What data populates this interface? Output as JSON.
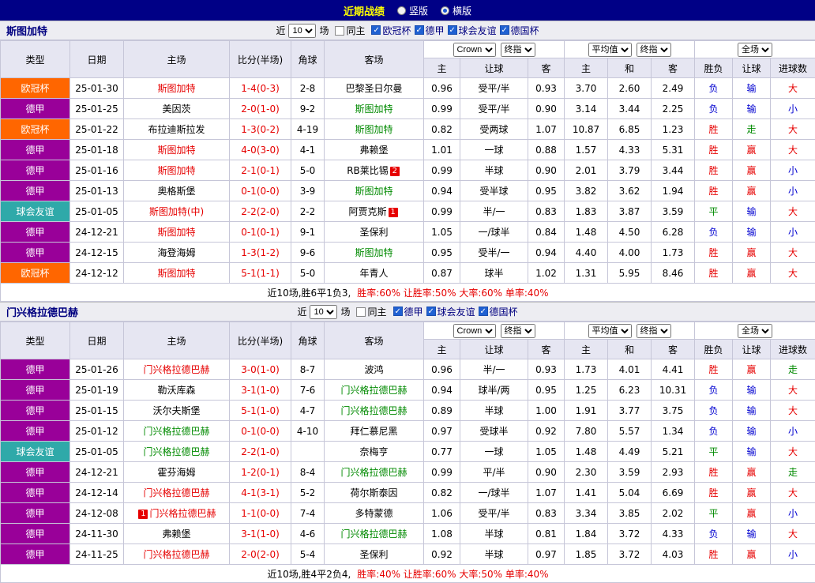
{
  "topbar": {
    "title": "近期战绩",
    "layout_options": [
      {
        "label": "竖版",
        "selected": false
      },
      {
        "label": "横版",
        "selected": true
      }
    ]
  },
  "colors": {
    "accent_navy": "#000086",
    "title_yellow": "#ffff00",
    "score_text": "#e60000",
    "type_bg": {
      "欧冠杯": "#ff6600",
      "德甲": "#990099",
      "球会友谊": "#2fa9a9"
    },
    "team_text": {
      "red": "#e60000",
      "green": "#008a00"
    },
    "result_text": {
      "胜": "#e60000",
      "赢": "#e60000",
      "大": "#e60000",
      "负": "#0000d0",
      "输": "#0000d0",
      "小": "#0000d0",
      "平": "#008a00",
      "走": "#008a00"
    }
  },
  "table_columns": [
    "类型",
    "日期",
    "主场",
    "比分(半场)",
    "角球",
    "客场",
    "主",
    "让球",
    "客",
    "主",
    "和",
    "客",
    "胜负",
    "让球",
    "进球数"
  ],
  "header_controls": {
    "near_label": "近",
    "near_value": "10",
    "games_label": "场",
    "odds_company": "Crown",
    "final_odds_label": "终指",
    "average_label": "平均值",
    "scope_label": "全场"
  },
  "sections": [
    {
      "team": "斯图加特",
      "filter": {
        "same_venue": {
          "label": "同主",
          "checked": false
        },
        "leagues": [
          {
            "label": "欧冠杯",
            "checked": true
          },
          {
            "label": "德甲",
            "checked": true
          },
          {
            "label": "球会友谊",
            "checked": true
          },
          {
            "label": "德国杯",
            "checked": true
          }
        ]
      },
      "rows": [
        {
          "type": "欧冠杯",
          "date": "25-01-30",
          "home": "斯图加特",
          "home_color": "red",
          "home_badge": "",
          "score": "1-4(0-3)",
          "corner": "2-8",
          "away": "巴黎圣日尔曼",
          "away_color": "",
          "away_badge": "",
          "odds": [
            "0.96",
            "受平/半",
            "0.93"
          ],
          "avg": [
            "3.70",
            "2.60",
            "2.49"
          ],
          "result": [
            "负",
            "输",
            "大"
          ]
        },
        {
          "type": "德甲",
          "date": "25-01-25",
          "home": "美因茨",
          "home_color": "",
          "home_badge": "",
          "score": "2-0(1-0)",
          "corner": "9-2",
          "away": "斯图加特",
          "away_color": "green",
          "away_badge": "",
          "odds": [
            "0.99",
            "受平/半",
            "0.90"
          ],
          "avg": [
            "3.14",
            "3.44",
            "2.25"
          ],
          "result": [
            "负",
            "输",
            "小"
          ]
        },
        {
          "type": "欧冠杯",
          "date": "25-01-22",
          "home": "布拉迪斯拉发",
          "home_color": "",
          "home_badge": "",
          "score": "1-3(0-2)",
          "corner": "4-19",
          "away": "斯图加特",
          "away_color": "green",
          "away_badge": "",
          "odds": [
            "0.82",
            "受两球",
            "1.07"
          ],
          "avg": [
            "10.87",
            "6.85",
            "1.23"
          ],
          "result": [
            "胜",
            "走",
            "大"
          ]
        },
        {
          "type": "德甲",
          "date": "25-01-18",
          "home": "斯图加特",
          "home_color": "red",
          "home_badge": "",
          "score": "4-0(3-0)",
          "corner": "4-1",
          "away": "弗赖堡",
          "away_color": "",
          "away_badge": "",
          "odds": [
            "1.01",
            "一球",
            "0.88"
          ],
          "avg": [
            "1.57",
            "4.33",
            "5.31"
          ],
          "result": [
            "胜",
            "赢",
            "大"
          ]
        },
        {
          "type": "德甲",
          "date": "25-01-16",
          "home": "斯图加特",
          "home_color": "red",
          "home_badge": "",
          "score": "2-1(0-1)",
          "corner": "5-0",
          "away": "RB莱比锡",
          "away_color": "",
          "away_badge": "2",
          "odds": [
            "0.99",
            "半球",
            "0.90"
          ],
          "avg": [
            "2.01",
            "3.79",
            "3.44"
          ],
          "result": [
            "胜",
            "赢",
            "小"
          ]
        },
        {
          "type": "德甲",
          "date": "25-01-13",
          "home": "奥格斯堡",
          "home_color": "",
          "home_badge": "",
          "score": "0-1(0-0)",
          "corner": "3-9",
          "away": "斯图加特",
          "away_color": "green",
          "away_badge": "",
          "odds": [
            "0.94",
            "受半球",
            "0.95"
          ],
          "avg": [
            "3.82",
            "3.62",
            "1.94"
          ],
          "result": [
            "胜",
            "赢",
            "小"
          ]
        },
        {
          "type": "球会友谊",
          "date": "25-01-05",
          "home": "斯图加特(中)",
          "home_color": "red",
          "home_badge": "",
          "score": "2-2(2-0)",
          "corner": "2-2",
          "away": "阿贾克斯",
          "away_color": "",
          "away_badge": "1",
          "odds": [
            "0.99",
            "半/一",
            "0.83"
          ],
          "avg": [
            "1.83",
            "3.87",
            "3.59"
          ],
          "result": [
            "平",
            "输",
            "大"
          ]
        },
        {
          "type": "德甲",
          "date": "24-12-21",
          "home": "斯图加特",
          "home_color": "red",
          "home_badge": "",
          "score": "0-1(0-1)",
          "corner": "9-1",
          "away": "圣保利",
          "away_color": "",
          "away_badge": "",
          "odds": [
            "1.05",
            "一/球半",
            "0.84"
          ],
          "avg": [
            "1.48",
            "4.50",
            "6.28"
          ],
          "result": [
            "负",
            "输",
            "小"
          ]
        },
        {
          "type": "德甲",
          "date": "24-12-15",
          "home": "海登海姆",
          "home_color": "",
          "home_badge": "",
          "score": "1-3(1-2)",
          "corner": "9-6",
          "away": "斯图加特",
          "away_color": "green",
          "away_badge": "",
          "odds": [
            "0.95",
            "受半/一",
            "0.94"
          ],
          "avg": [
            "4.40",
            "4.00",
            "1.73"
          ],
          "result": [
            "胜",
            "赢",
            "大"
          ]
        },
        {
          "type": "欧冠杯",
          "date": "24-12-12",
          "home": "斯图加特",
          "home_color": "red",
          "home_badge": "",
          "score": "5-1(1-1)",
          "corner": "5-0",
          "away": "年青人",
          "away_color": "",
          "away_badge": "",
          "odds": [
            "0.87",
            "球半",
            "1.02"
          ],
          "avg": [
            "1.31",
            "5.95",
            "8.46"
          ],
          "result": [
            "胜",
            "赢",
            "大"
          ]
        }
      ],
      "summary": {
        "record": "近10场,胜6平1负3,",
        "stats": "胜率:60% 让胜率:50% 大率:60% 单率:40%"
      }
    },
    {
      "team": "门兴格拉德巴赫",
      "filter": {
        "same_venue": {
          "label": "同主",
          "checked": false
        },
        "leagues": [
          {
            "label": "德甲",
            "checked": true
          },
          {
            "label": "球会友谊",
            "checked": true
          },
          {
            "label": "德国杯",
            "checked": true
          }
        ]
      },
      "rows": [
        {
          "type": "德甲",
          "date": "25-01-26",
          "home": "门兴格拉德巴赫",
          "home_color": "red",
          "home_badge": "",
          "score": "3-0(1-0)",
          "corner": "8-7",
          "away": "波鸿",
          "away_color": "",
          "away_badge": "",
          "odds": [
            "0.96",
            "半/一",
            "0.93"
          ],
          "avg": [
            "1.73",
            "4.01",
            "4.41"
          ],
          "result": [
            "胜",
            "赢",
            "走"
          ]
        },
        {
          "type": "德甲",
          "date": "25-01-19",
          "home": "勒沃库森",
          "home_color": "",
          "home_badge": "",
          "score": "3-1(1-0)",
          "corner": "7-6",
          "away": "门兴格拉德巴赫",
          "away_color": "green",
          "away_badge": "",
          "odds": [
            "0.94",
            "球半/两",
            "0.95"
          ],
          "avg": [
            "1.25",
            "6.23",
            "10.31"
          ],
          "result": [
            "负",
            "输",
            "大"
          ]
        },
        {
          "type": "德甲",
          "date": "25-01-15",
          "home": "沃尔夫斯堡",
          "home_color": "",
          "home_badge": "",
          "score": "5-1(1-0)",
          "corner": "4-7",
          "away": "门兴格拉德巴赫",
          "away_color": "green",
          "away_badge": "",
          "odds": [
            "0.89",
            "半球",
            "1.00"
          ],
          "avg": [
            "1.91",
            "3.77",
            "3.75"
          ],
          "result": [
            "负",
            "输",
            "大"
          ]
        },
        {
          "type": "德甲",
          "date": "25-01-12",
          "home": "门兴格拉德巴赫",
          "home_color": "green",
          "home_badge": "",
          "score": "0-1(0-0)",
          "corner": "4-10",
          "away": "拜仁慕尼黑",
          "away_color": "",
          "away_badge": "",
          "odds": [
            "0.97",
            "受球半",
            "0.92"
          ],
          "avg": [
            "7.80",
            "5.57",
            "1.34"
          ],
          "result": [
            "负",
            "输",
            "小"
          ]
        },
        {
          "type": "球会友谊",
          "date": "25-01-05",
          "home": "门兴格拉德巴赫",
          "home_color": "green",
          "home_badge": "",
          "score": "2-2(1-0)",
          "corner": "",
          "away": "奈梅亨",
          "away_color": "",
          "away_badge": "",
          "odds": [
            "0.77",
            "一球",
            "1.05"
          ],
          "avg": [
            "1.48",
            "4.49",
            "5.21"
          ],
          "result": [
            "平",
            "输",
            "大"
          ]
        },
        {
          "type": "德甲",
          "date": "24-12-21",
          "home": "霍芬海姆",
          "home_color": "",
          "home_badge": "",
          "score": "1-2(0-1)",
          "corner": "8-4",
          "away": "门兴格拉德巴赫",
          "away_color": "green",
          "away_badge": "",
          "odds": [
            "0.99",
            "平/半",
            "0.90"
          ],
          "avg": [
            "2.30",
            "3.59",
            "2.93"
          ],
          "result": [
            "胜",
            "赢",
            "走"
          ]
        },
        {
          "type": "德甲",
          "date": "24-12-14",
          "home": "门兴格拉德巴赫",
          "home_color": "red",
          "home_badge": "",
          "score": "4-1(3-1)",
          "corner": "5-2",
          "away": "荷尔斯泰因",
          "away_color": "",
          "away_badge": "",
          "odds": [
            "0.82",
            "一/球半",
            "1.07"
          ],
          "avg": [
            "1.41",
            "5.04",
            "6.69"
          ],
          "result": [
            "胜",
            "赢",
            "大"
          ]
        },
        {
          "type": "德甲",
          "date": "24-12-08",
          "home": "门兴格拉德巴赫",
          "home_color": "red",
          "home_badge": "1",
          "score": "1-1(0-0)",
          "corner": "7-4",
          "away": "多特蒙德",
          "away_color": "",
          "away_badge": "",
          "odds": [
            "1.06",
            "受平/半",
            "0.83"
          ],
          "avg": [
            "3.34",
            "3.85",
            "2.02"
          ],
          "result": [
            "平",
            "赢",
            "小"
          ]
        },
        {
          "type": "德甲",
          "date": "24-11-30",
          "home": "弗赖堡",
          "home_color": "",
          "home_badge": "",
          "score": "3-1(1-0)",
          "corner": "4-6",
          "away": "门兴格拉德巴赫",
          "away_color": "green",
          "away_badge": "",
          "odds": [
            "1.08",
            "半球",
            "0.81"
          ],
          "avg": [
            "1.84",
            "3.72",
            "4.33"
          ],
          "result": [
            "负",
            "输",
            "大"
          ]
        },
        {
          "type": "德甲",
          "date": "24-11-25",
          "home": "门兴格拉德巴赫",
          "home_color": "red",
          "home_badge": "",
          "score": "2-0(2-0)",
          "corner": "5-4",
          "away": "圣保利",
          "away_color": "",
          "away_badge": "",
          "odds": [
            "0.92",
            "半球",
            "0.97"
          ],
          "avg": [
            "1.85",
            "3.72",
            "4.03"
          ],
          "result": [
            "胜",
            "赢",
            "小"
          ]
        }
      ],
      "summary": {
        "record": "近10场,胜4平2负4,",
        "stats": "胜率:40% 让胜率:60% 大率:50% 单率:40%"
      }
    }
  ]
}
